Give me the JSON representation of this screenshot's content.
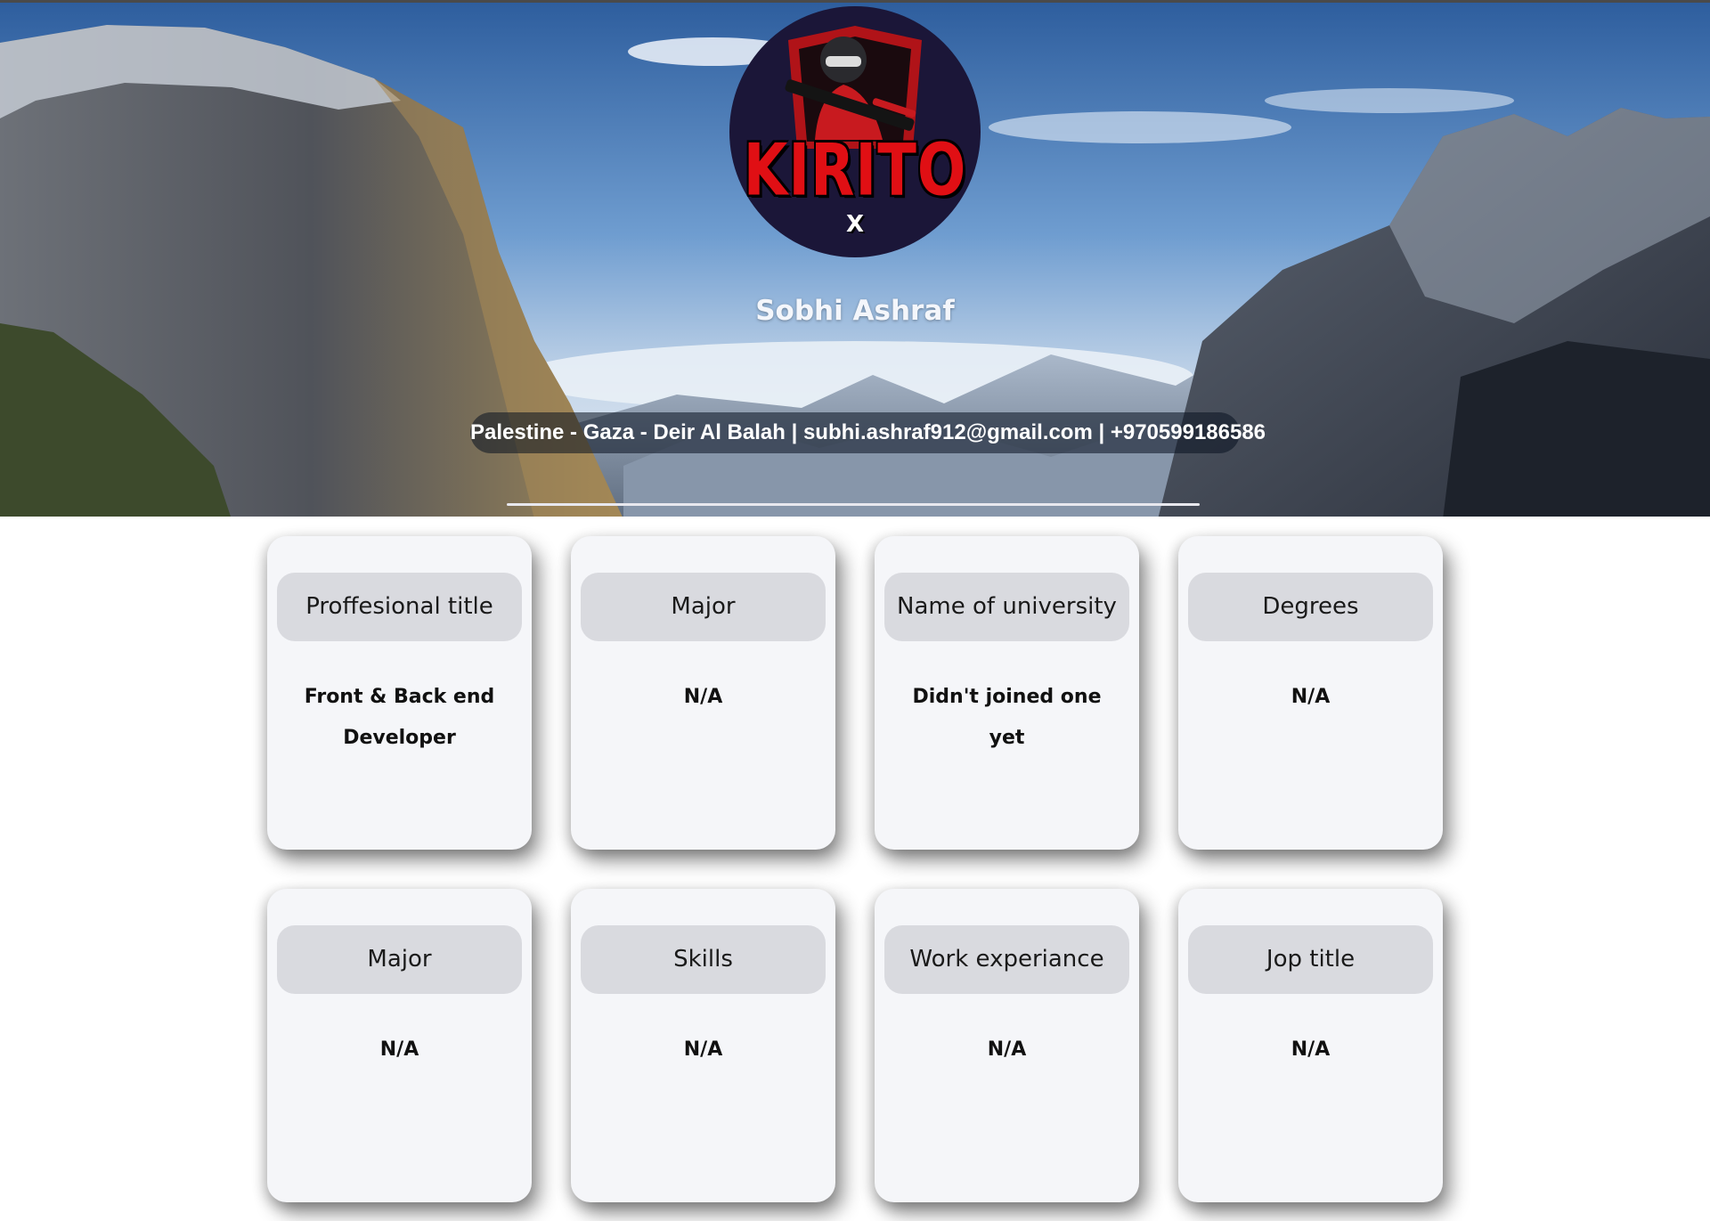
{
  "profile": {
    "name": "Sobhi Ashraf",
    "avatar_wordmark": "KIRITO",
    "avatar_sub": "X",
    "contact": "Palestine - Gaza - Deir Al Balah | subhi.ashraf912@gmail.com | +970599186586"
  },
  "cards": [
    {
      "title": "Proffesional title",
      "value": "Front & Back end Developer"
    },
    {
      "title": "Major",
      "value": "N/A"
    },
    {
      "title": "Name of university",
      "value": "Didn't joined one yet"
    },
    {
      "title": "Degrees",
      "value": "N/A"
    },
    {
      "title": "Major",
      "value": "N/A"
    },
    {
      "title": "Skills",
      "value": "N/A"
    },
    {
      "title": "Work experiance",
      "value": "N/A"
    },
    {
      "title": "Jop title",
      "value": "N/A"
    }
  ],
  "colors": {
    "card_background": "#f5f6f9",
    "card_header": "#d9dadf",
    "avatar_background": "#1b1638",
    "avatar_wordmark": "#e00f14"
  }
}
